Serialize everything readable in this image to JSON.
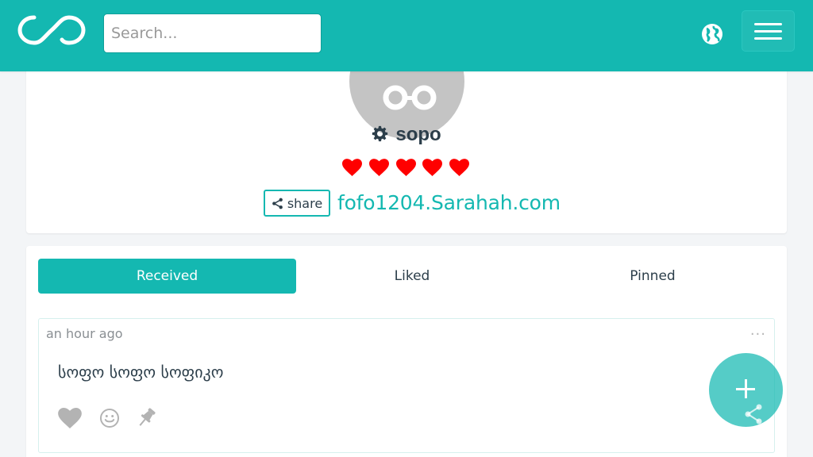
{
  "header": {
    "logo_icon": "infinity-logo-icon",
    "search_placeholder": "Search...",
    "globe_icon": "globe-icon",
    "menu_icon": "hamburger-menu-icon",
    "brand_color": "#14b8b1"
  },
  "profile": {
    "avatar_icon": "default-avatar-icon",
    "settings_icon": "gear-icon",
    "username": "sopo",
    "hearts_filled": 5,
    "hearts_total": 5,
    "heart_color": "#ff0000",
    "share_label": "share",
    "share_icon": "share-icon",
    "link_text": "fofo1204.Sarahah.com"
  },
  "tabs": [
    {
      "label": "Received",
      "active": true
    },
    {
      "label": "Liked",
      "active": false
    },
    {
      "label": "Pinned",
      "active": false
    }
  ],
  "messages": [
    {
      "time": "an hour ago",
      "more_label": "...",
      "text": "სოფო სოფო სოფიკო",
      "actions": [
        "heart-icon",
        "smiley-icon",
        "pin-icon"
      ]
    }
  ],
  "fab": {
    "label": "+",
    "icon": "plus-icon",
    "secondary_icon": "share-icon"
  }
}
